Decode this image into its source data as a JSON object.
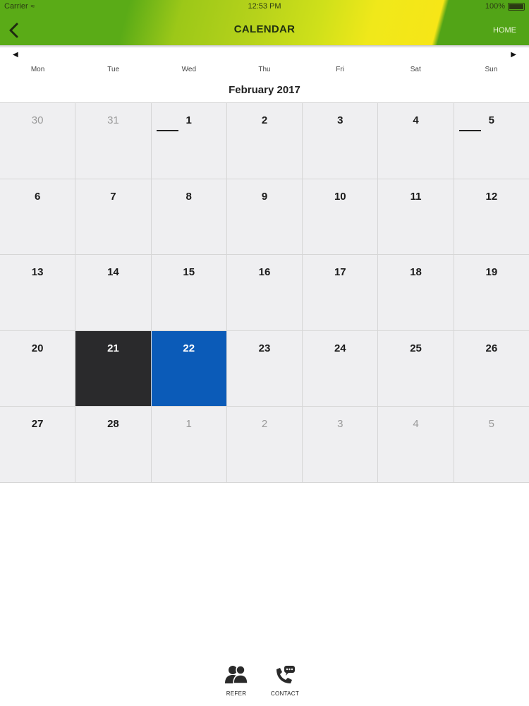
{
  "status_bar": {
    "carrier": "Carrier",
    "time": "12:53 PM",
    "battery": "100%"
  },
  "header": {
    "title": "CALENDAR",
    "home_label": "HOME",
    "back_icon": "chevron-left-icon"
  },
  "nav": {
    "prev_icon": "triangle-left-icon",
    "next_icon": "triangle-right-icon",
    "prev_glyph": "◀",
    "next_glyph": "▶"
  },
  "weekdays": [
    "Mon",
    "Tue",
    "Wed",
    "Thu",
    "Fri",
    "Sat",
    "Sun"
  ],
  "month_title": "February 2017",
  "weeks": [
    [
      {
        "day": "30",
        "other": true
      },
      {
        "day": "31",
        "other": true
      },
      {
        "day": "1",
        "event": true
      },
      {
        "day": "2"
      },
      {
        "day": "3"
      },
      {
        "day": "4"
      },
      {
        "day": "5",
        "event": true
      }
    ],
    [
      {
        "day": "6"
      },
      {
        "day": "7"
      },
      {
        "day": "8"
      },
      {
        "day": "9"
      },
      {
        "day": "10"
      },
      {
        "day": "11"
      },
      {
        "day": "12"
      }
    ],
    [
      {
        "day": "13"
      },
      {
        "day": "14"
      },
      {
        "day": "15"
      },
      {
        "day": "16"
      },
      {
        "day": "17"
      },
      {
        "day": "18"
      },
      {
        "day": "19"
      }
    ],
    [
      {
        "day": "20"
      },
      {
        "day": "21",
        "state": "today"
      },
      {
        "day": "22",
        "state": "selected"
      },
      {
        "day": "23"
      },
      {
        "day": "24"
      },
      {
        "day": "25"
      },
      {
        "day": "26"
      }
    ],
    [
      {
        "day": "27"
      },
      {
        "day": "28"
      },
      {
        "day": "1",
        "other": true
      },
      {
        "day": "2",
        "other": true
      },
      {
        "day": "3",
        "other": true
      },
      {
        "day": "4",
        "other": true
      },
      {
        "day": "5",
        "other": true
      }
    ]
  ],
  "colors": {
    "header_green": "#5aab17",
    "header_yellow": "#f0e81a",
    "today_bg": "#2a2a2c",
    "selected_bg": "#0b5bb8",
    "cell_bg": "#efeff1"
  },
  "tabbar": {
    "refer": {
      "label": "REFER",
      "icon": "people-icon"
    },
    "contact": {
      "label": "CONTACT",
      "icon": "phone-chat-icon"
    }
  }
}
